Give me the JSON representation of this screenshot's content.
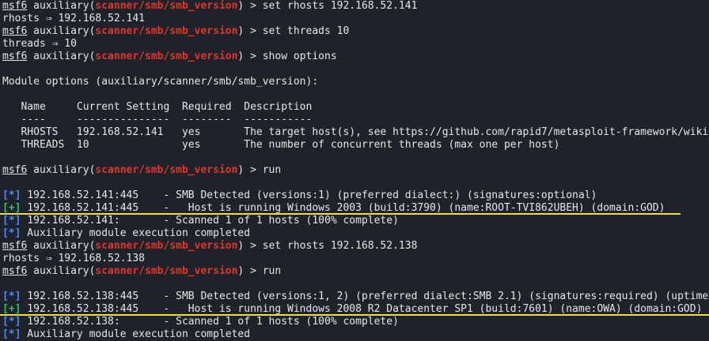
{
  "terminal": {
    "lines": [
      {
        "type": "prompt",
        "msf": "msf6",
        "mid": " auxiliary(",
        "path": "scanner/smb/smb_version",
        "end": ") > set rhosts 192.168.52.141"
      },
      {
        "type": "text",
        "text": "rhosts ⇒ 192.168.52.141"
      },
      {
        "type": "prompt",
        "msf": "msf6",
        "mid": " auxiliary(",
        "path": "scanner/smb/smb_version",
        "end": ") > set threads 10"
      },
      {
        "type": "text",
        "text": "threads ⇒ 10"
      },
      {
        "type": "prompt",
        "msf": "msf6",
        "mid": " auxiliary(",
        "path": "scanner/smb/smb_version",
        "end": ") > show options"
      },
      {
        "type": "text",
        "text": ""
      },
      {
        "type": "text",
        "text": "Module options (auxiliary/scanner/smb/smb_version):"
      },
      {
        "type": "text",
        "text": ""
      },
      {
        "type": "text",
        "text": "   Name     Current Setting  Required  Description"
      },
      {
        "type": "text",
        "text": "   ----     ---------------  --------  -----------"
      },
      {
        "type": "text",
        "text": "   RHOSTS   192.168.52.141   yes       The target host(s), see https://github.com/rapid7/metasploit-framework/wiki"
      },
      {
        "type": "text",
        "text": "   THREADS  10               yes       The number of concurrent threads (max one per host)"
      },
      {
        "type": "text",
        "text": ""
      },
      {
        "type": "prompt",
        "msf": "msf6",
        "mid": " auxiliary(",
        "path": "scanner/smb/smb_version",
        "end": ") > run"
      },
      {
        "type": "text",
        "text": ""
      },
      {
        "type": "mark",
        "mark": "[*]",
        "cls": "mark-blue",
        "text": " 192.168.52.141:445    - SMB Detected (versions:1) (preferred dialect:) (signatures:optional)"
      },
      {
        "type": "mark",
        "mark": "[+]",
        "cls": "mark-green",
        "text": " 192.168.52.141:445    -   Host is running Windows 2003 (build:3790) (name:ROOT-TVI862UBEH) (domain:GOD)"
      },
      {
        "type": "mark",
        "mark": "[*]",
        "cls": "mark-blue",
        "text": " 192.168.52.141:       - Scanned 1 of 1 hosts (100% complete)"
      },
      {
        "type": "mark",
        "mark": "[*]",
        "cls": "mark-blue",
        "text": " Auxiliary module execution completed"
      },
      {
        "type": "prompt",
        "msf": "msf6",
        "mid": " auxiliary(",
        "path": "scanner/smb/smb_version",
        "end": ") > set rhosts 192.168.52.138"
      },
      {
        "type": "text",
        "text": "rhosts ⇒ 192.168.52.138"
      },
      {
        "type": "prompt",
        "msf": "msf6",
        "mid": " auxiliary(",
        "path": "scanner/smb/smb_version",
        "end": ") > run"
      },
      {
        "type": "text",
        "text": ""
      },
      {
        "type": "mark",
        "mark": "[*]",
        "cls": "mark-blue",
        "text": " 192.168.52.138:445    - SMB Detected (versions:1, 2) (preferred dialect:SMB 2.1) (signatures:required) (uptime"
      },
      {
        "type": "mark",
        "mark": "[+]",
        "cls": "mark-green",
        "text": " 192.168.52.138:445    -   Host is running Windows 2008 R2 Datacenter SP1 (build:7601) (name:OWA) (domain:GOD)"
      },
      {
        "type": "mark",
        "mark": "[*]",
        "cls": "mark-blue",
        "text": " 192.168.52.138:       - Scanned 1 of 1 hosts (100% complete)"
      },
      {
        "type": "mark",
        "mark": "[*]",
        "cls": "mark-blue",
        "text": " Auxiliary module execution completed"
      }
    ]
  },
  "colors": {
    "background": "#1f2329",
    "prompt_path": "#e0342f",
    "info_mark": "#4a8cf6",
    "success_mark": "#38c25a",
    "highlight_underline": "#f4e030"
  }
}
